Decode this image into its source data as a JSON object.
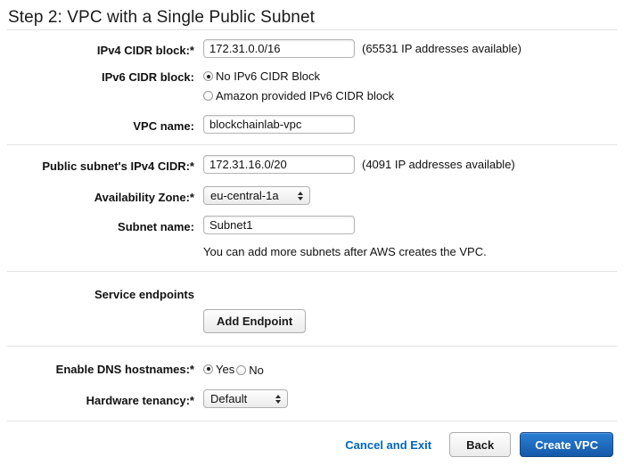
{
  "page": {
    "title": "Step 2: VPC with a Single Public Subnet"
  },
  "fields": {
    "ipv4_cidr": {
      "label": "IPv4 CIDR block:*",
      "value": "172.31.0.0/16",
      "helper": "(65531 IP addresses available)"
    },
    "ipv6_cidr": {
      "label": "IPv6 CIDR block:",
      "options": [
        {
          "label": "No IPv6 CIDR Block",
          "selected": true
        },
        {
          "label": "Amazon provided IPv6 CIDR block",
          "selected": false
        }
      ]
    },
    "vpc_name": {
      "label": "VPC name:",
      "value": "blockchainlab-vpc"
    },
    "public_subnet_cidr": {
      "label": "Public subnet's IPv4 CIDR:*",
      "value": "172.31.16.0/20",
      "helper": "(4091 IP addresses available)"
    },
    "availability_zone": {
      "label": "Availability Zone:*",
      "value": "eu-central-1a"
    },
    "subnet_name": {
      "label": "Subnet name:",
      "value": "Subnet1",
      "helper": "You can add more subnets after AWS creates the VPC."
    },
    "service_endpoints": {
      "label": "Service endpoints",
      "add_button": "Add Endpoint"
    },
    "dns_hostnames": {
      "label": "Enable DNS hostnames:*",
      "options": [
        {
          "label": "Yes",
          "selected": true
        },
        {
          "label": "No",
          "selected": false
        }
      ]
    },
    "hardware_tenancy": {
      "label": "Hardware tenancy:*",
      "value": "Default"
    }
  },
  "footer": {
    "cancel_label": "Cancel and Exit",
    "back_label": "Back",
    "create_label": "Create VPC"
  },
  "colors": {
    "link_blue": "#0066c0",
    "primary_button": "#1a64b8",
    "divider": "#e2e2e2"
  }
}
